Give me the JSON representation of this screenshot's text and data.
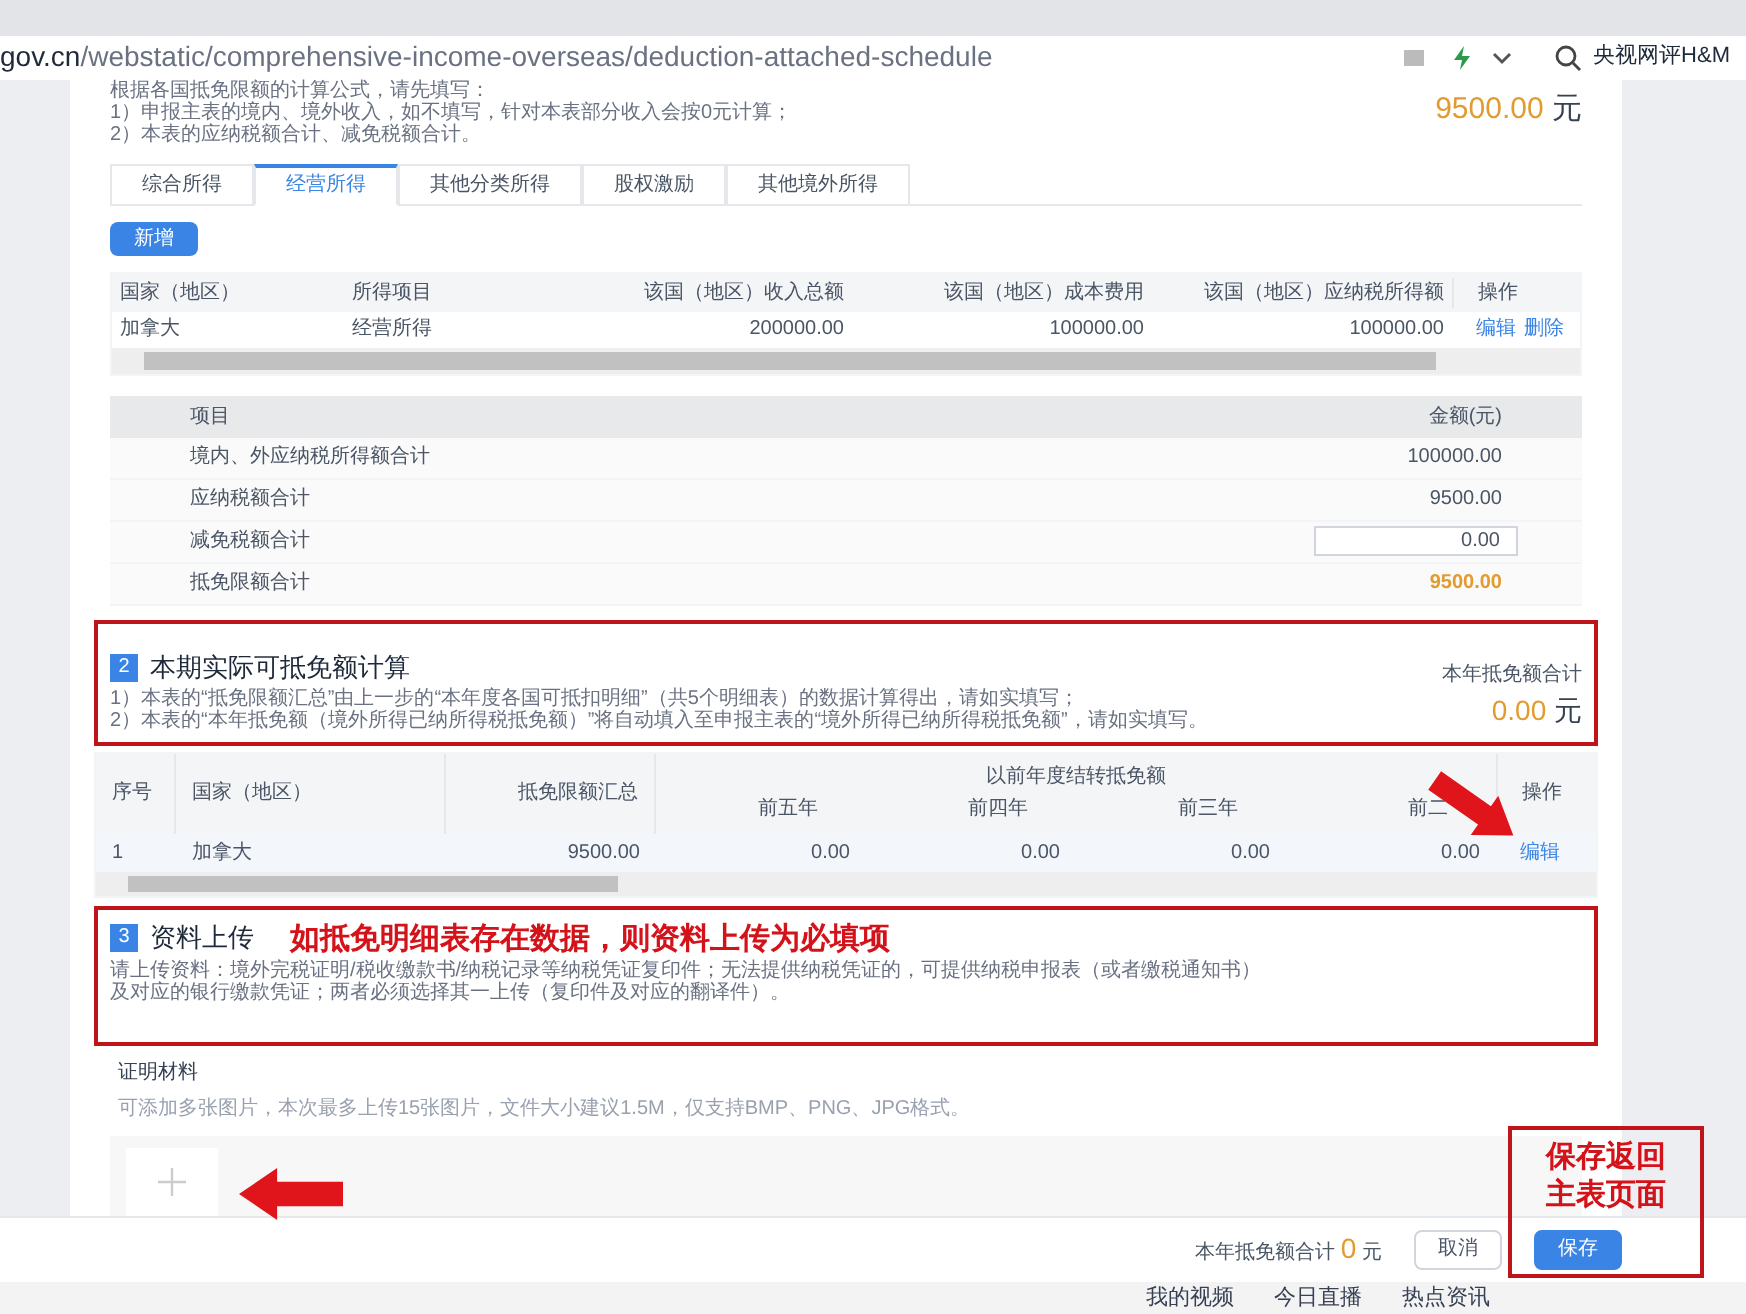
{
  "browser": {
    "url_host": "gov.cn",
    "url_path": "/webstatic/comprehensive-income-overseas/deduction-attached-schedule",
    "search_text": "央视网评H&M"
  },
  "intro": {
    "lines": [
      "根据各国抵免限额的计算公式，请先填写：",
      "1）申报主表的境内、境外收入，如不填写，针对本表部分收入会按0元计算；",
      "2）本表的应纳税额合计、减免税额合计。"
    ],
    "total_value": "9500.00",
    "total_unit": "元"
  },
  "tabs": [
    {
      "label": "综合所得",
      "selected": false
    },
    {
      "label": "经营所得",
      "selected": true
    },
    {
      "label": "其他分类所得",
      "selected": false
    },
    {
      "label": "股权激励",
      "selected": false
    },
    {
      "label": "其他境外所得",
      "selected": false
    }
  ],
  "add_button": "新增",
  "income_table": {
    "columns": [
      "国家（地区）",
      "所得项目",
      "该国（地区）收入总额",
      "该国（地区）成本费用",
      "该国（地区）应纳税所得额",
      "操作"
    ],
    "rows": [
      {
        "cells": [
          "加拿大",
          "经营所得",
          "200000.00",
          "100000.00",
          "100000.00"
        ],
        "actions": [
          "编辑",
          "删除"
        ]
      }
    ]
  },
  "summary_table": {
    "columns": [
      "项目",
      "金额(元)"
    ],
    "rows": [
      {
        "kind": "text",
        "label": "境内、外应纳税所得额合计",
        "value": "100000.00"
      },
      {
        "kind": "text",
        "label": "应纳税额合计",
        "value": "9500.00"
      },
      {
        "kind": "input",
        "label": "减免税额合计",
        "value": "0.00"
      },
      {
        "kind": "highlight",
        "label": "抵免限额合计",
        "value": "9500.00"
      }
    ]
  },
  "section2": {
    "number": "2",
    "title": "本期实际可抵免额计算",
    "lines": [
      "1）本表的“抵免限额汇总”由上一步的“本年度各国可抵扣明细”（共5个明细表）的数据计算得出，请如实填写；",
      "2）本表的“本年抵免额（境外所得已纳所得税抵免额）”将自动填入至申报主表的“境外所得已纳所得税抵免额”，请如实填写。"
    ],
    "total_label": "本年抵免额合计",
    "total_value": "0.00",
    "total_unit": "元"
  },
  "credit_table": {
    "columns": [
      "序号",
      "国家（地区）",
      "抵免限额汇总"
    ],
    "group_label": "以前年度结转抵免额",
    "sub_columns": [
      "前五年",
      "前四年",
      "前三年",
      "前二"
    ],
    "action_column": "操作",
    "rows": [
      {
        "cells": [
          "1",
          "加拿大",
          "9500.00",
          "0.00",
          "0.00",
          "0.00",
          "0.00"
        ],
        "action": "编辑"
      }
    ]
  },
  "section3": {
    "number": "3",
    "title": "资料上传",
    "lines": [
      "请上传资料：境外完税证明/税收缴款书/纳税记录等纳税凭证复印件；无法提供纳税凭证的，可提供纳税申报表（或者缴税通知书）",
      "及对应的银行缴款凭证；两者必须选择其一上传（复印件及对应的翻译件）。"
    ]
  },
  "attachments": {
    "label": "证明材料",
    "hint": "可添加多张图片，本次最多上传15张图片，文件大小建议1.5M，仅支持BMP、PNG、JPG格式。"
  },
  "footer": {
    "total_label": "本年抵免额合计",
    "total_value": "0",
    "total_unit": "元",
    "buttons": [
      {
        "label": "取消",
        "kind": "secondary"
      },
      {
        "label": "保存",
        "kind": "primary"
      }
    ]
  },
  "taskbar": [
    "我的视频",
    "今日直播",
    "热点资讯"
  ],
  "annotations": [
    {
      "text": "如抵免明细表存在数据，则资料上传为必填项"
    },
    {
      "text": "保存返回主表页面"
    }
  ]
}
